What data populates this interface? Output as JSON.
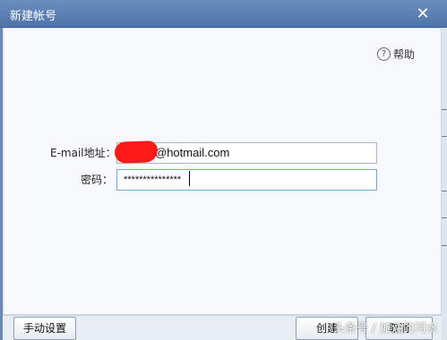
{
  "window": {
    "title": "新建帐号",
    "close_icon": "close-icon"
  },
  "help": {
    "label": "帮助",
    "icon": "question-circle-icon",
    "icon_glyph": "?"
  },
  "form": {
    "email_label": "E-mail地址：",
    "email_value": "@hotmail.com",
    "password_label": "密码：",
    "password_value": "***************"
  },
  "footer": {
    "manual_button": "手动设置",
    "create_button": "创建",
    "cancel_button": "取消"
  },
  "watermark": "头条号 / 加油的河水"
}
